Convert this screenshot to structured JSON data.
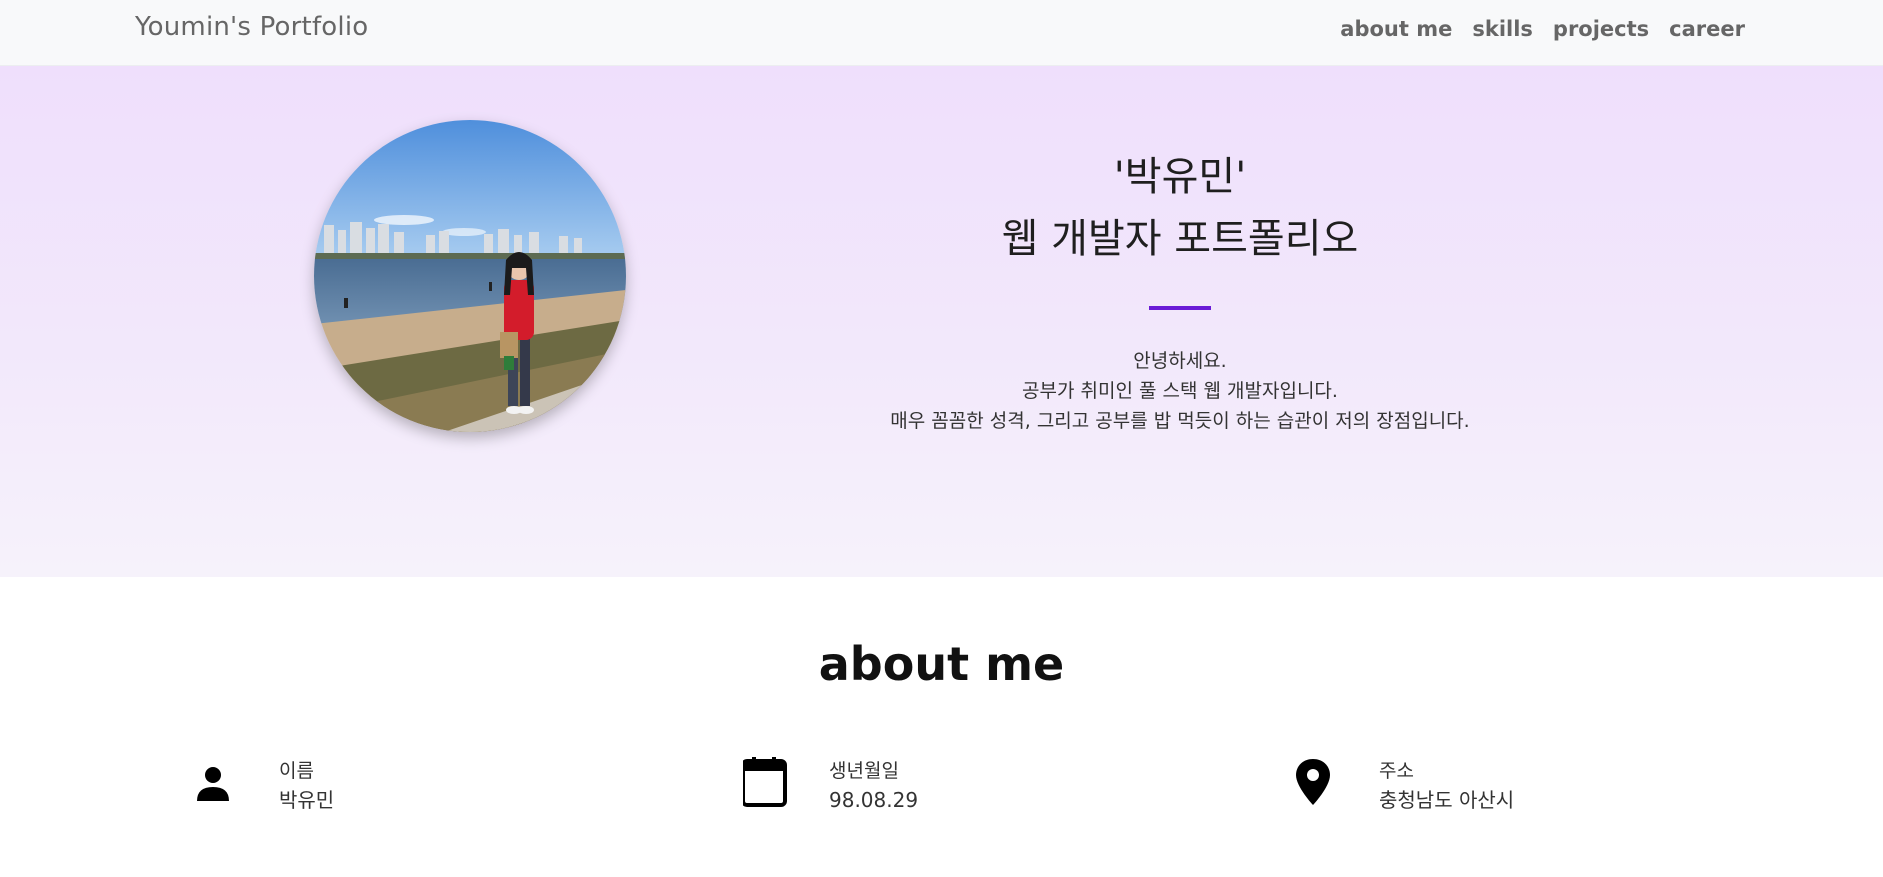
{
  "navbar": {
    "brand": "Youmin's Portfolio",
    "links": [
      {
        "label": "about me"
      },
      {
        "label": "skills"
      },
      {
        "label": "projects"
      },
      {
        "label": "career"
      }
    ]
  },
  "hero": {
    "title_line1": "'박유민'",
    "title_line2": "웹 개발자 포트폴리오",
    "accent_color": "#6a1bd6",
    "description": [
      "안녕하세요.",
      "공부가 취미인 풀 스택 웹 개발자입니다.",
      "매우 꼼꼼한 성격, 그리고 공부를 밥 먹듯이 하는 습관이 저의 장점입니다."
    ]
  },
  "about": {
    "heading": "about me",
    "items": [
      {
        "icon": "person-icon",
        "label": "이름",
        "value": "박유민"
      },
      {
        "icon": "calendar-icon",
        "label": "생년월일",
        "value": "98.08.29"
      },
      {
        "icon": "location-pin-icon",
        "label": "주소",
        "value": "충청남도 아산시"
      }
    ]
  }
}
